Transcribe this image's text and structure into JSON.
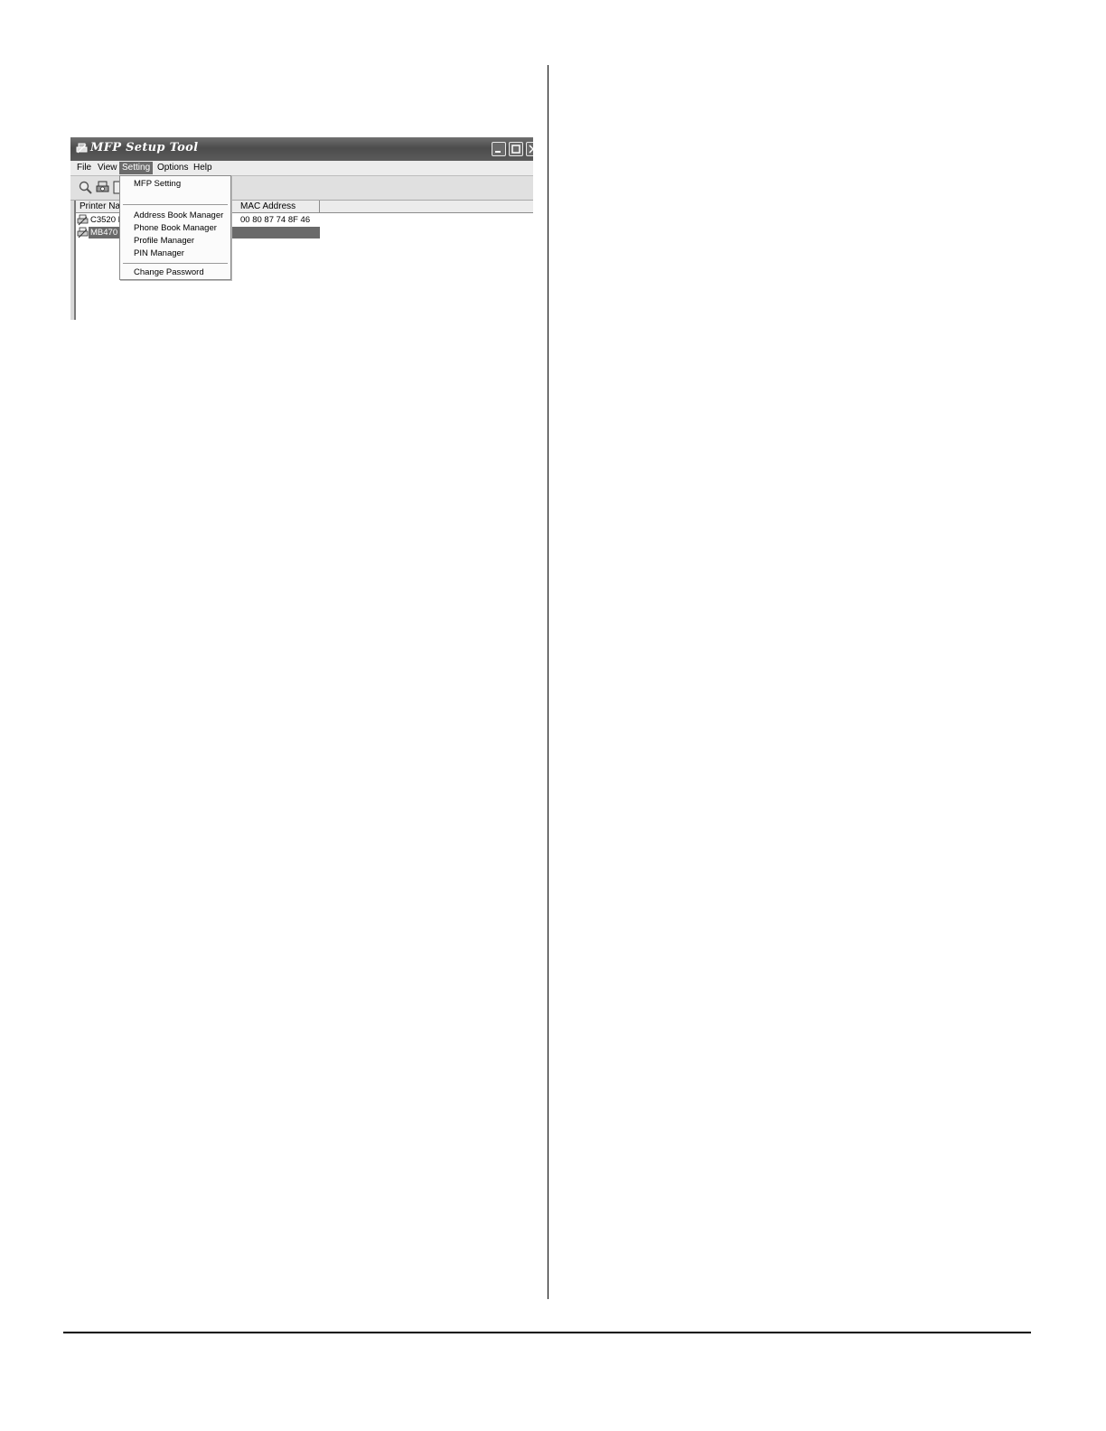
{
  "window": {
    "title": "MFP Setup Tool"
  },
  "menubar": {
    "items": [
      "File",
      "View",
      "Setting",
      "Options",
      "Help"
    ],
    "active": "Setting"
  },
  "list": {
    "columns": [
      "Printer Nam",
      "MAC Address"
    ],
    "rows": [
      {
        "name": "C3520 M",
        "mac": "00 80 87 74 8F 46",
        "selected": false
      },
      {
        "name": "MB470",
        "mac": "",
        "selected": true
      }
    ]
  },
  "setting_menu": {
    "items": [
      "MFP Setting",
      "Address Book Manager",
      "Phone Book Manager",
      "Profile Manager",
      "PIN Manager",
      "Change Password"
    ]
  }
}
